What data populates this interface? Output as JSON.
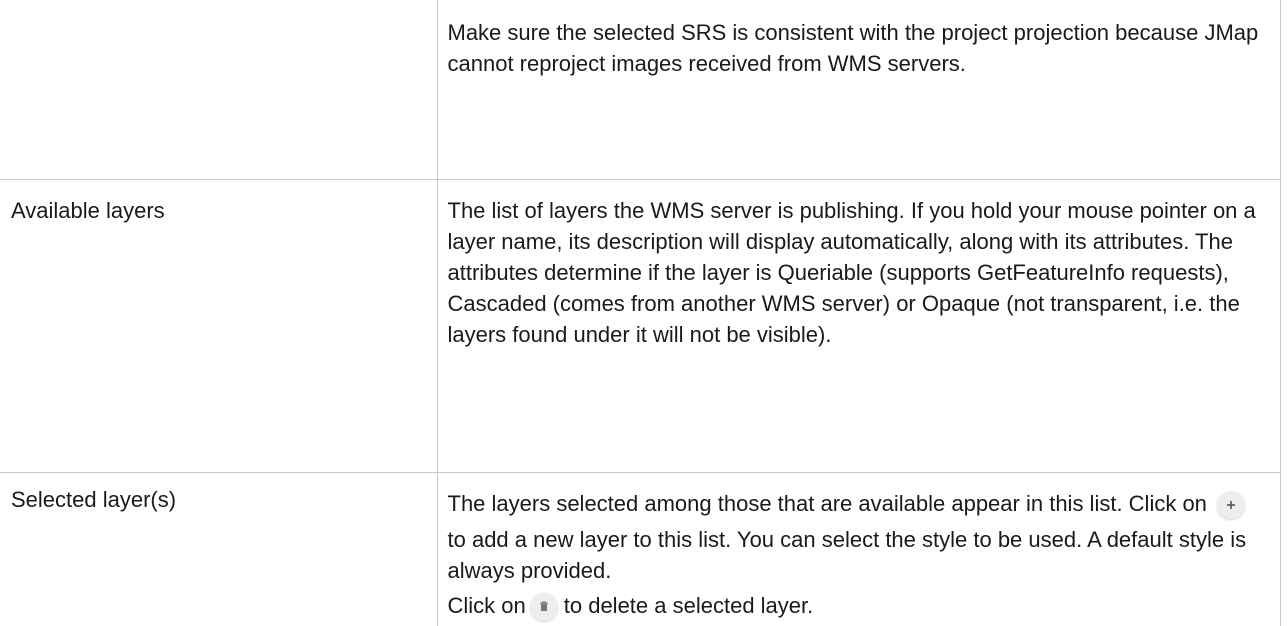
{
  "rows": [
    {
      "label": "",
      "description": "Make sure the selected SRS is consistent with the project projection because JMap cannot reproject images received from WMS servers."
    },
    {
      "label": "Available layers",
      "description": "The list of layers the WMS server is publishing. If you hold your mouse pointer on a layer name, its description will display automatically, along with its attributes. The attributes determine if the layer is Queriable (supports GetFeatureInfo requests), Cascaded (comes from another WMS server) or Opaque (not transparent, i.e. the layers found under it will not be visible)."
    },
    {
      "label": "Selected layer(s)",
      "description_part1": "The layers selected among those that are available appear in this list. Click on",
      "description_part2": "to add a new layer to this list. You can select the style to be used. A default style is always provided.",
      "description_part3": "Click on",
      "description_part4": "to delete a selected layer."
    }
  ],
  "icons": {
    "add": "plus-icon",
    "delete": "trash-icon"
  }
}
